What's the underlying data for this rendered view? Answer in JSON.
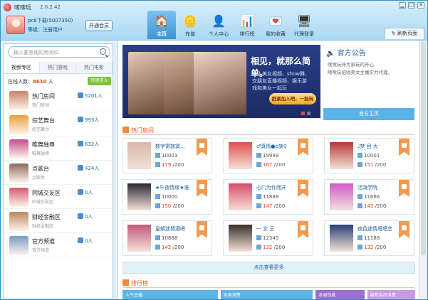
{
  "app": {
    "name": "嗦嗦玩",
    "version": "2.0.2.42",
    "win": [
      "▁",
      "□",
      "✕"
    ]
  },
  "user": {
    "name": "pc6下载(5007350)",
    "level": "等级：注册用户",
    "vip": "开通会员"
  },
  "nav": [
    {
      "label": "主页",
      "icon": "home-icon",
      "glyph": "🏠",
      "active": true
    },
    {
      "label": "充值",
      "icon": "coins-icon",
      "glyph": "🪙"
    },
    {
      "label": "个人中心",
      "icon": "user-center-icon",
      "glyph": "👤"
    },
    {
      "label": "排行榜",
      "icon": "bar-chart-icon",
      "glyph": "📊"
    },
    {
      "label": "我的收藏",
      "icon": "favorites-icon",
      "glyph": "💌"
    },
    {
      "label": "代理登录",
      "icon": "monitor-icon",
      "glyph": "🖥"
    }
  ],
  "refresh": "↻ 刷新页面",
  "search": {
    "placeholder": "输入要查询的房间ID"
  },
  "side_tabs": [
    "视频专区",
    "热门游戏",
    "热门电影"
  ],
  "online": {
    "label": "在线人数",
    "count": "8610",
    "unit": "人"
  },
  "quick": "快速进入",
  "categories": [
    {
      "name": "热门房间",
      "sub": "热门房间",
      "count": "5201人",
      "color": "#c9826b"
    },
    {
      "name": "综艺舞台",
      "sub": "综艺舞台",
      "count": "993人",
      "color": "#e6a23a"
    },
    {
      "name": "唯舞独尊",
      "sub": "唯舞独尊",
      "count": "632人",
      "color": "#c44f8e"
    },
    {
      "name": "点歌台",
      "sub": "点歌台",
      "count": "424人",
      "color": "#8a6b5a"
    },
    {
      "name": "同城交友区",
      "sub": "同城交友区",
      "count": "0人",
      "color": "#d45a6d"
    },
    {
      "name": "财经金融区",
      "sub": "财经金融区",
      "count": "0人",
      "color": "#b88a5a"
    },
    {
      "name": "官方频道",
      "sub": "官方频道",
      "count": "0人",
      "color": "#7a9bc0"
    }
  ],
  "banner": {
    "headline": "相见，就那么简单。",
    "lines": [
      "真人美女视频、show舞、",
      "交朋友直播视频、娱乐游",
      "戏和美女一起玩"
    ],
    "button": "赶紧加入吧，一起玩",
    "girls": [
      {
        "x": 8,
        "w": 50,
        "color": "#e9c7b6"
      },
      {
        "x": 52,
        "w": 48,
        "color": "#d8b49b"
      },
      {
        "x": 96,
        "w": 78,
        "color": "#f1d6c8"
      }
    ]
  },
  "notice": {
    "title": "官方公告",
    "lines": [
      "嗦嗦玩伴大家玩的开心",
      "嗦嗦玩招收美女主播实力代理。"
    ],
    "button": "官方主页"
  },
  "hot_title": "热门房间",
  "rooms": [
    {
      "name": "数字寄寂寞...",
      "id": "10003",
      "online": "179",
      "cap": "/200",
      "color": "#d9b8a8"
    },
    {
      "name": "♂真情●e族♀",
      "id": "19999",
      "online": "167",
      "cap": "/200",
      "color": "#e05050"
    },
    {
      "name": "♩梦 回 大",
      "id": "10001",
      "online": "151",
      "cap": "/200",
      "color": "#b83a3a"
    },
    {
      "name": "★午夜情缘★谁",
      "id": "10000",
      "online": "150",
      "cap": "/200",
      "color": "#2a2a33"
    },
    {
      "name": "心门为你而开",
      "id": "11888",
      "online": "147",
      "cap": "/200",
      "color": "#d84a6a"
    },
    {
      "name": "活泼学院",
      "id": "11666",
      "online": "143",
      "cap": "/200",
      "color": "#d15ac8"
    },
    {
      "name": "皇朝迷情酒吧",
      "id": "10888",
      "online": "142",
      "cap": "/200",
      "color": "#c05a7a"
    },
    {
      "name": "一 女 王",
      "id": "12345",
      "online": "132",
      "cap": "/200",
      "color": "#3a2f2a"
    },
    {
      "name": "夜色迷情缠缠恋",
      "id": "11188",
      "online": "132",
      "cap": "/200",
      "color": "#2a3f7a"
    }
  ],
  "more": "点击查看更多",
  "rank_title": "排行榜",
  "rank_tabs": [
    {
      "label": "人气主播",
      "color": "#5bb5e6"
    },
    {
      "label": "本周消费",
      "color": "#5bb5e6"
    },
    {
      "label": "本周热度",
      "color": "#9b6fcf"
    },
    {
      "label": "最新会员消费",
      "color": "#c89ae3"
    }
  ]
}
